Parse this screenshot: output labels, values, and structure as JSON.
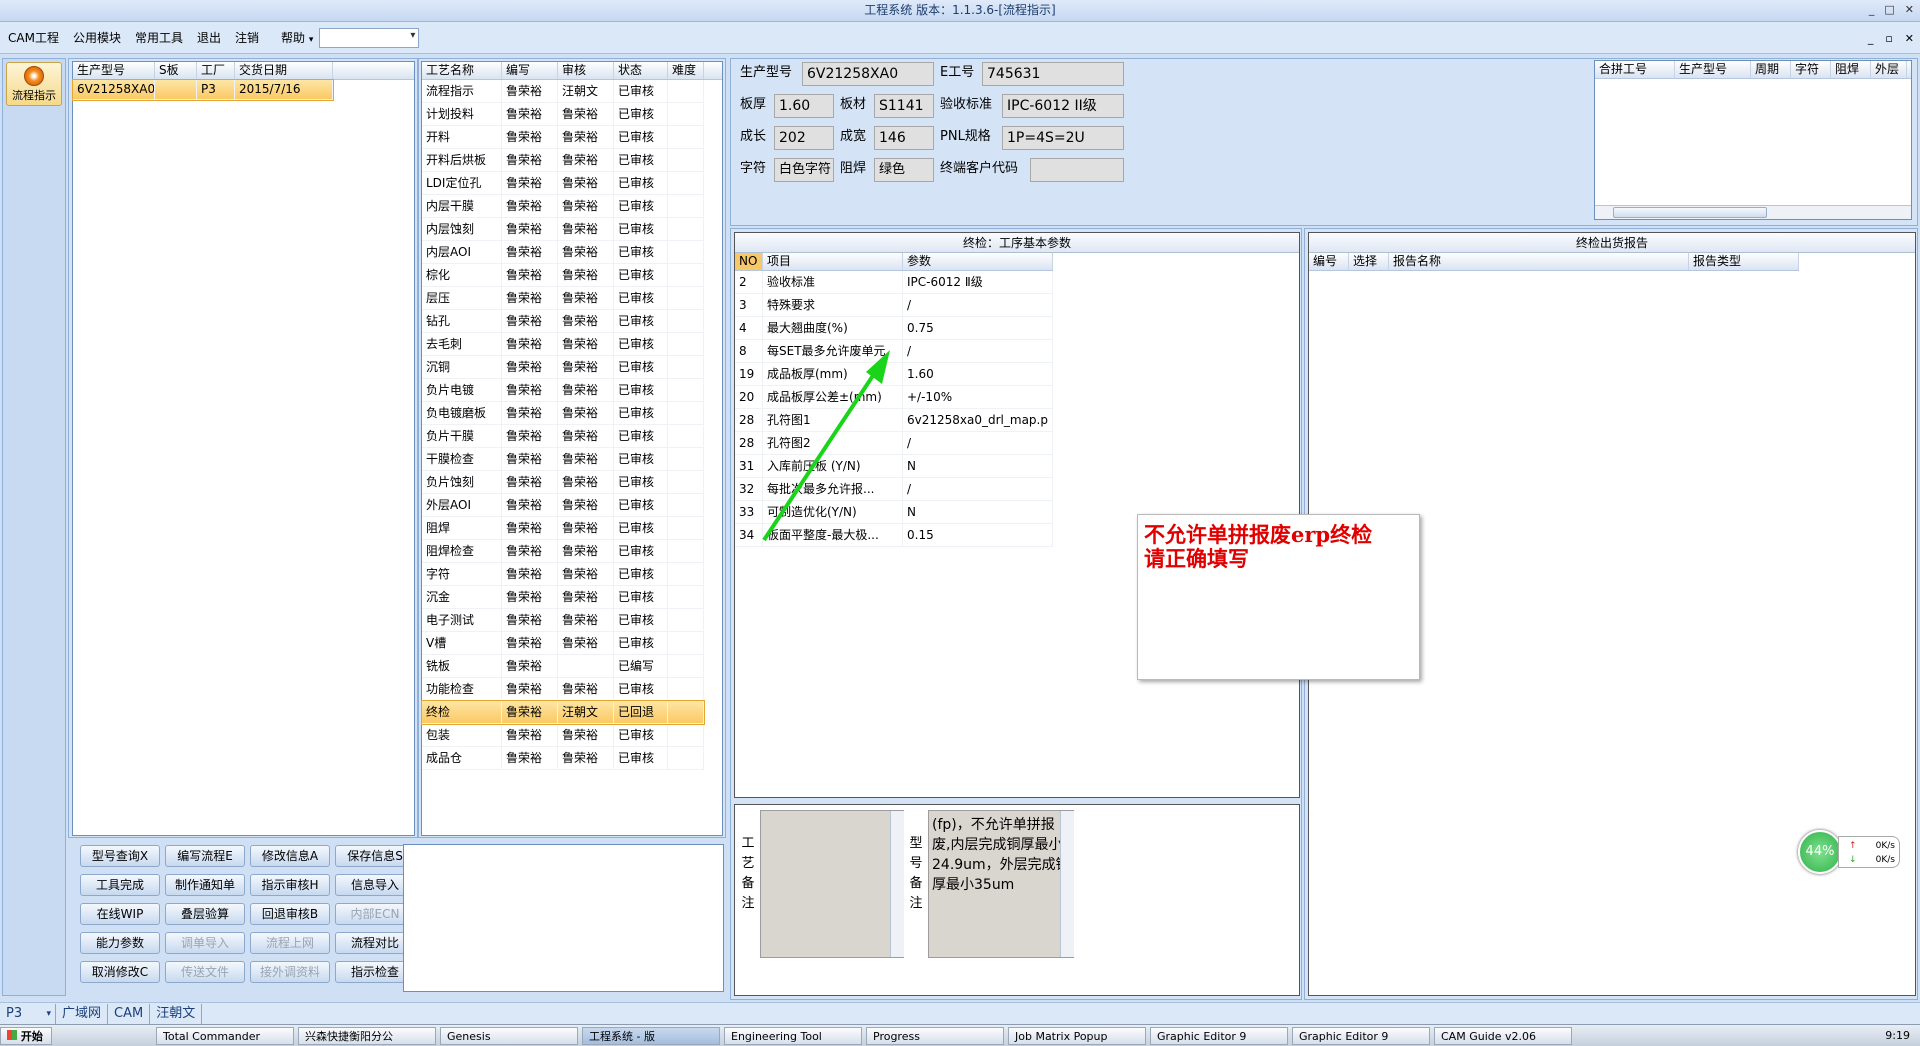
{
  "window": {
    "title": "工程系统 版本：1.1.3.6-[流程指示]",
    "min": "_",
    "max": "□",
    "close": "✕"
  },
  "menu": {
    "items": [
      "CAM工程",
      "公用模块",
      "常用工具",
      "退出",
      "注销",
      "帮助"
    ],
    "help_arrow": "▾"
  },
  "mdi": {
    "min": "_",
    "restore": "▫",
    "close": "✕"
  },
  "sidebar": {
    "flow_button": "流程指示"
  },
  "order_table": {
    "headers": [
      "生产型号",
      "S板",
      "工厂",
      "交货日期"
    ],
    "rows": [
      [
        "6V21258XA0",
        "",
        "P3",
        "2015/7/16"
      ]
    ]
  },
  "process_table": {
    "headers": [
      "工艺名称",
      "编写",
      "审核",
      "状态",
      "难度"
    ],
    "rows": [
      [
        "流程指示",
        "鲁荣裕",
        "汪朝文",
        "已审核",
        ""
      ],
      [
        "计划投料",
        "鲁荣裕",
        "鲁荣裕",
        "已审核",
        ""
      ],
      [
        "开料",
        "鲁荣裕",
        "鲁荣裕",
        "已审核",
        ""
      ],
      [
        "开料后烘板",
        "鲁荣裕",
        "鲁荣裕",
        "已审核",
        ""
      ],
      [
        "LDI定位孔",
        "鲁荣裕",
        "鲁荣裕",
        "已审核",
        ""
      ],
      [
        "内层干膜",
        "鲁荣裕",
        "鲁荣裕",
        "已审核",
        ""
      ],
      [
        "内层蚀刻",
        "鲁荣裕",
        "鲁荣裕",
        "已审核",
        ""
      ],
      [
        "内层AOI",
        "鲁荣裕",
        "鲁荣裕",
        "已审核",
        ""
      ],
      [
        "棕化",
        "鲁荣裕",
        "鲁荣裕",
        "已审核",
        ""
      ],
      [
        "层压",
        "鲁荣裕",
        "鲁荣裕",
        "已审核",
        ""
      ],
      [
        "钻孔",
        "鲁荣裕",
        "鲁荣裕",
        "已审核",
        ""
      ],
      [
        "去毛刺",
        "鲁荣裕",
        "鲁荣裕",
        "已审核",
        ""
      ],
      [
        "沉铜",
        "鲁荣裕",
        "鲁荣裕",
        "已审核",
        ""
      ],
      [
        "负片电镀",
        "鲁荣裕",
        "鲁荣裕",
        "已审核",
        ""
      ],
      [
        "负电镀磨板",
        "鲁荣裕",
        "鲁荣裕",
        "已审核",
        ""
      ],
      [
        "负片干膜",
        "鲁荣裕",
        "鲁荣裕",
        "已审核",
        ""
      ],
      [
        "干膜检查",
        "鲁荣裕",
        "鲁荣裕",
        "已审核",
        ""
      ],
      [
        "负片蚀刻",
        "鲁荣裕",
        "鲁荣裕",
        "已审核",
        ""
      ],
      [
        "外层AOI",
        "鲁荣裕",
        "鲁荣裕",
        "已审核",
        ""
      ],
      [
        "阻焊",
        "鲁荣裕",
        "鲁荣裕",
        "已审核",
        ""
      ],
      [
        "阻焊检查",
        "鲁荣裕",
        "鲁荣裕",
        "已审核",
        ""
      ],
      [
        "字符",
        "鲁荣裕",
        "鲁荣裕",
        "已审核",
        ""
      ],
      [
        "沉金",
        "鲁荣裕",
        "鲁荣裕",
        "已审核",
        ""
      ],
      [
        "电子测试",
        "鲁荣裕",
        "鲁荣裕",
        "已审核",
        ""
      ],
      [
        "V槽",
        "鲁荣裕",
        "鲁荣裕",
        "已审核",
        ""
      ],
      [
        "铣板",
        "鲁荣裕",
        "",
        "已编写",
        ""
      ],
      [
        "功能检查",
        "鲁荣裕",
        "鲁荣裕",
        "已审核",
        ""
      ],
      [
        "终检",
        "鲁荣裕",
        "汪朝文",
        "已回退",
        ""
      ],
      [
        "包装",
        "鲁荣裕",
        "鲁荣裕",
        "已审核",
        ""
      ],
      [
        "成品仓",
        "鲁荣裕",
        "鲁荣裕",
        "已审核",
        ""
      ]
    ],
    "selected_index": 27
  },
  "buttons": [
    [
      "型号查询X",
      "编写流程E",
      "修改信息A",
      "保存信息S"
    ],
    [
      "工具完成",
      "制作通知单",
      "指示审核H",
      "信息导入"
    ],
    [
      "在线WIP",
      "叠层验算",
      "回退审核B",
      "内部ECN"
    ],
    [
      "能力参数",
      "调单导入",
      "流程上网",
      "流程对比"
    ],
    [
      "取消修改C",
      "传送文件",
      "接外调资料",
      "指示检查"
    ]
  ],
  "disabled_buttons": [
    "内部ECN",
    "调单导入",
    "流程上网",
    "传送文件",
    "接外调资料"
  ],
  "info": {
    "prod_model_label": "生产型号",
    "prod_model": "6V21258XA0",
    "e_no_label": "E工号",
    "e_no": "745631",
    "thickness_label": "板厚",
    "thickness": "1.60",
    "material_label": "板材",
    "material": "S1141",
    "accept_label": "验收标准",
    "accept": "IPC-6012 II级",
    "length_label": "成长",
    "length": "202",
    "width_label": "成宽",
    "width": "146",
    "pnl_label": "PNL规格",
    "pnl": "1P=4S=2U",
    "char_label": "字符",
    "char": "白色字符",
    "mask_label": "阻焊",
    "mask": "绿色",
    "cust_label": "终端客户代码",
    "cust": ""
  },
  "merge_table": {
    "headers": [
      "合拼工号",
      "生产型号",
      "周期",
      "字符",
      "阻焊",
      "外层"
    ]
  },
  "param_box": {
    "title": "终检：工序基本参数",
    "headers": [
      "NO",
      "项目",
      "参数"
    ],
    "rows": [
      [
        "2",
        "验收标准",
        "IPC-6012 Ⅱ级"
      ],
      [
        "3",
        "特殊要求",
        "/"
      ],
      [
        "4",
        "最大翘曲度(%)",
        "0.75"
      ],
      [
        "8",
        "每SET最多允许废单元",
        "/"
      ],
      [
        "19",
        "成品板厚(mm)",
        "1.60"
      ],
      [
        "20",
        "成品板厚公差±(mm)",
        "+/-10%"
      ],
      [
        "28",
        "孔符图1",
        "6v21258xa0_drl_map.p"
      ],
      [
        "28",
        "孔符图2",
        "/"
      ],
      [
        "31",
        "入库前压板 (Y/N)",
        "N"
      ],
      [
        "32",
        "每批次最多允许报...",
        "/"
      ],
      [
        "33",
        "可制造优化(Y/N)",
        "N"
      ],
      [
        "34",
        "板面平整度-最大极...",
        "0.15"
      ]
    ]
  },
  "report_box": {
    "title": "终检出货报告",
    "headers": [
      "编号",
      "选择",
      "报告名称",
      "报告类型"
    ]
  },
  "note": {
    "line1": "不允许单拼报废erp终检",
    "line2": "请正确填写"
  },
  "remarks": {
    "process_label": "工艺备注",
    "process_text": "",
    "type_label": "型号备注",
    "type_text": "(fp)，不允许单拼报废,内层完成铜厚最小24.9um，外层完成铜厚最小35um"
  },
  "speed": {
    "percent": "44%",
    "up": "0K/s",
    "down": "0K/s",
    "up_arrow": "↑",
    "down_arrow": "↓"
  },
  "status": {
    "factory": "P3",
    "tabs": [
      "广域网",
      "CAM",
      "汪朝文"
    ]
  },
  "taskbar": {
    "start": "开始",
    "items": [
      "Total Commander",
      "兴森快捷衡阳分公",
      "Genesis",
      "工程系统 - 版",
      "Engineering Tool",
      "Progress",
      "Job Matrix Popup",
      "Graphic Editor 9",
      "Graphic Editor 9",
      "CAM Guide v2.06"
    ],
    "active_index": 3,
    "clock": "9:19"
  },
  "colors": {
    "accent": "#fbc963",
    "note_text": "#e10000",
    "arrow": "#19d419",
    "speed": "#2fb24a"
  }
}
